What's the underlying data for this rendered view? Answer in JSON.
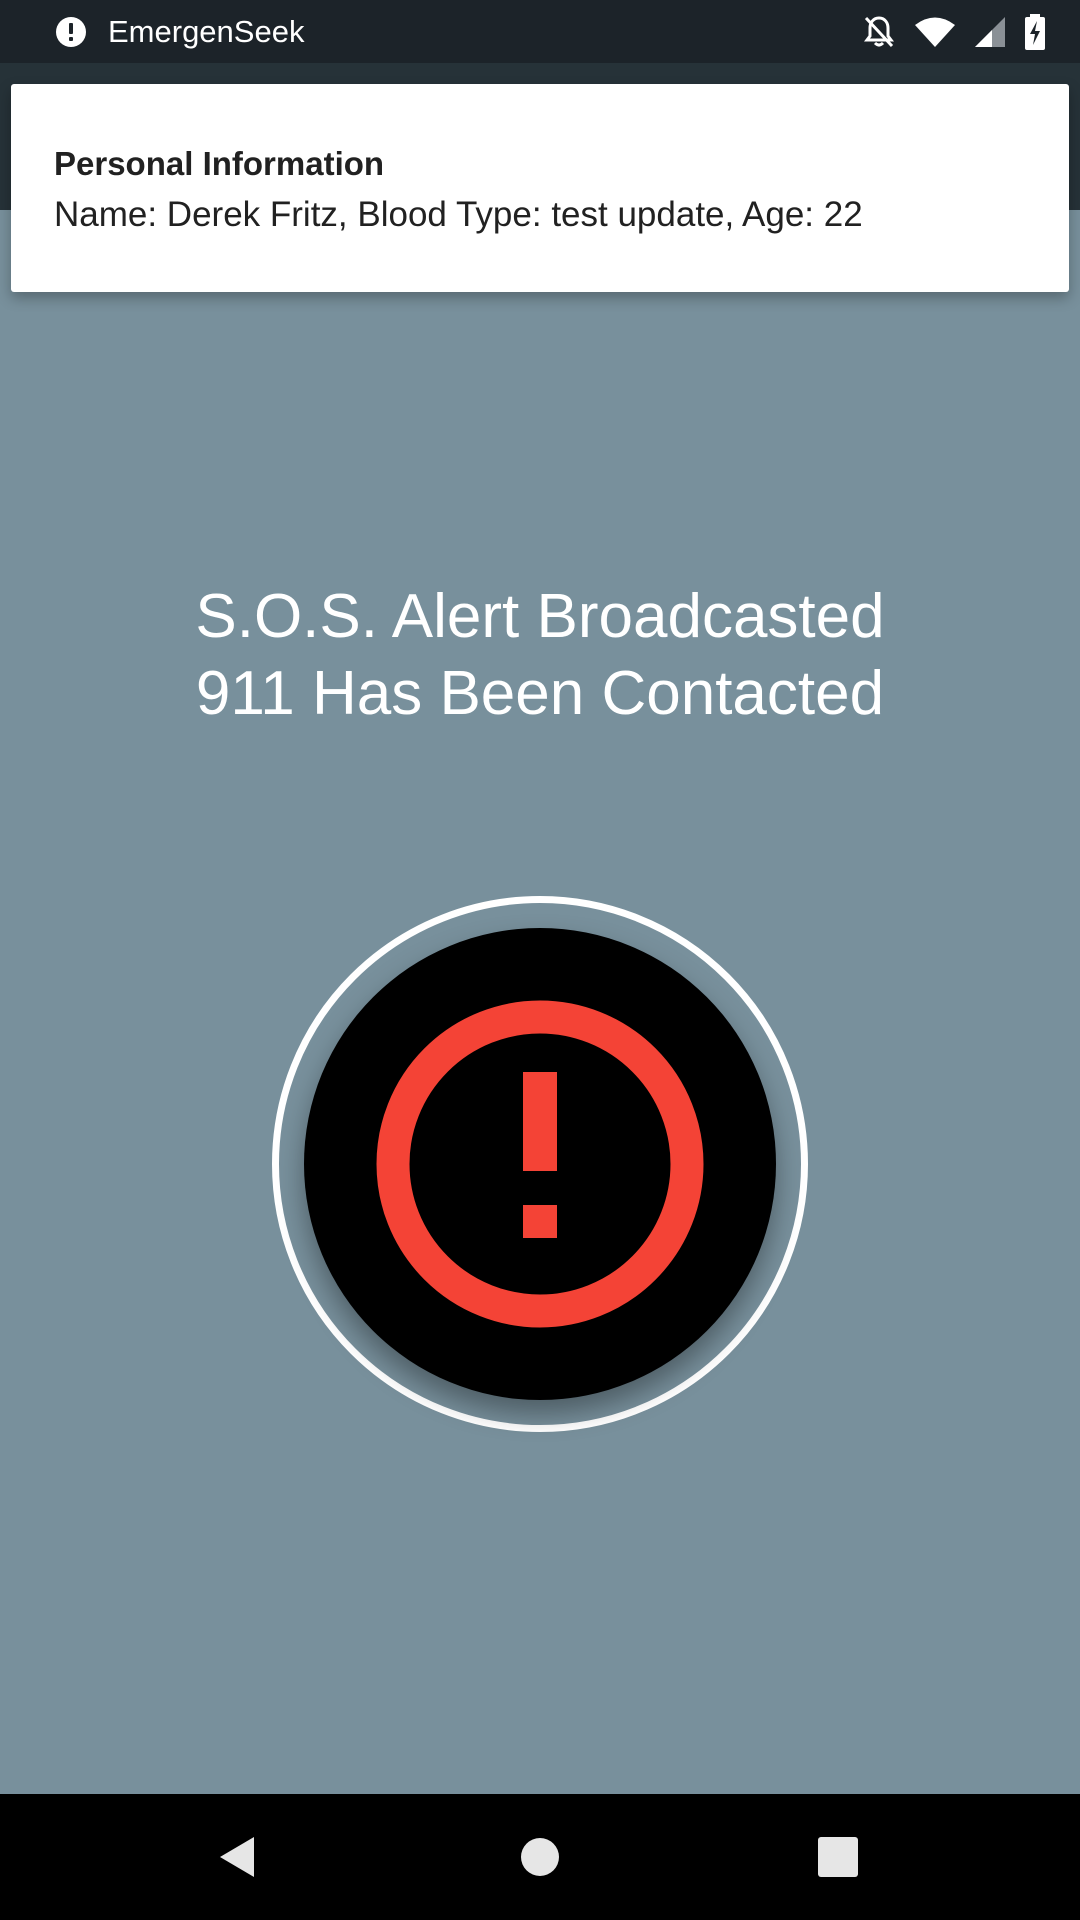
{
  "status_bar": {
    "app_name": "EmergenSeek",
    "icons": [
      "alert-icon",
      "notifications-off-icon",
      "wifi-icon",
      "cell-signal-icon",
      "battery-charging-icon"
    ]
  },
  "notification": {
    "title": "Personal Information",
    "body": "Name: Derek Fritz, Blood Type: test update, Age: 22"
  },
  "main": {
    "line1": "S.O.S. Alert Broadcasted",
    "line2": "911 Has Been Contacted",
    "sos_icon": "alert-circle-icon"
  },
  "nav_bar": {
    "buttons": [
      "back-icon",
      "home-icon",
      "recents-icon"
    ]
  },
  "colors": {
    "background": "#78909c",
    "status_bar": "#1c2329",
    "app_bar": "#263238",
    "accent_red": "#f44336",
    "button_black": "#000000"
  }
}
